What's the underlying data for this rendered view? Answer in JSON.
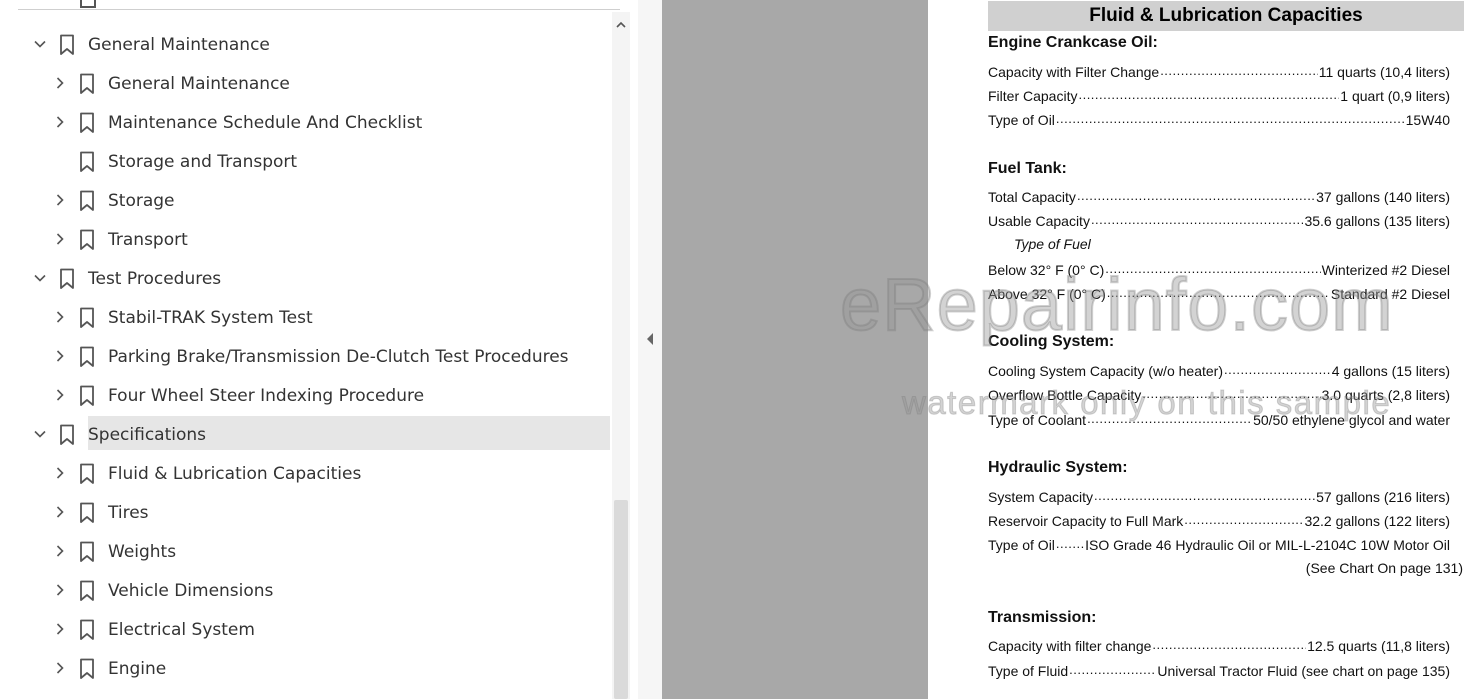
{
  "sidebar": {
    "items": [
      {
        "label": "General Maintenance",
        "level": 0,
        "expanded": true
      },
      {
        "label": "General Maintenance",
        "level": 1,
        "expanded": false
      },
      {
        "label": "Maintenance Schedule And Checklist",
        "level": 1,
        "expanded": false
      },
      {
        "label": "Storage and Transport",
        "level": 1,
        "leaf": true
      },
      {
        "label": "Storage",
        "level": 1,
        "expanded": false
      },
      {
        "label": "Transport",
        "level": 1,
        "expanded": false
      },
      {
        "label": "Test Procedures",
        "level": 0,
        "expanded": true
      },
      {
        "label": "Stabil-TRAK System Test",
        "level": 1,
        "expanded": false
      },
      {
        "label": "Parking Brake/Transmission De-Clutch Test Procedures",
        "level": 1,
        "expanded": false
      },
      {
        "label": "Four Wheel Steer Indexing Procedure",
        "level": 1,
        "expanded": false
      },
      {
        "label": "Specifications",
        "level": 0,
        "expanded": true,
        "selected": true
      },
      {
        "label": "Fluid & Lubrication Capacities",
        "level": 1,
        "expanded": false
      },
      {
        "label": "Tires",
        "level": 1,
        "expanded": false
      },
      {
        "label": "Weights",
        "level": 1,
        "expanded": false
      },
      {
        "label": "Vehicle Dimensions",
        "level": 1,
        "expanded": false
      },
      {
        "label": "Electrical System",
        "level": 1,
        "expanded": false
      },
      {
        "label": "Engine",
        "level": 1,
        "expanded": false
      }
    ]
  },
  "document": {
    "title": "Fluid & Lubrication Capacities",
    "sections": [
      {
        "heading": "Engine Crankcase Oil:",
        "rows": [
          {
            "label": "Capacity with Filter Change",
            "value": "11 quarts (10,4 liters)"
          },
          {
            "label": "Filter Capacity",
            "value": "1 quart (0,9 liters)"
          },
          {
            "label": "Type of Oil",
            "value": "15W40"
          }
        ]
      },
      {
        "heading": "Fuel Tank:",
        "rows": [
          {
            "label": "Total Capacity",
            "value": "37 gallons (140 liters)"
          },
          {
            "label": "Usable Capacity",
            "value": "35.6 gallons (135 liters)"
          },
          {
            "label": "Below 32° F (0° C)",
            "value": "Winterized #2 Diesel"
          },
          {
            "label": "Above 32° F (0° C)",
            "value": "Standard #2 Diesel"
          }
        ],
        "subheading": "Type of Fuel"
      },
      {
        "heading": "Cooling System:",
        "rows": [
          {
            "label": "Cooling System Capacity (w/o heater)",
            "value": "4 gallons (15 liters)"
          },
          {
            "label": "Overflow Bottle Capacity",
            "value": "3.0 quarts (2,8 liters)"
          },
          {
            "label": "Type of Coolant",
            "value": "50/50 ethylene glycol and water"
          }
        ]
      },
      {
        "heading": "Hydraulic System:",
        "rows": [
          {
            "label": "System Capacity",
            "value": "57 gallons (216 liters)"
          },
          {
            "label": "Reservoir Capacity to Full Mark",
            "value": "32.2 gallons (122 liters)"
          },
          {
            "label": "Type of Oil",
            "value": "ISO Grade 46 Hydraulic Oil or MIL-L-2104C 10W Motor Oil"
          }
        ],
        "note": "(See Chart On page 131)"
      },
      {
        "heading": "Transmission:",
        "rows": [
          {
            "label": "Capacity with filter change",
            "value": "12.5 quarts (11,8 liters)"
          },
          {
            "label": "Type of Fluid",
            "value": "Universal Tractor Fluid (see chart on page 135)"
          }
        ]
      }
    ]
  },
  "watermark": {
    "main": "eRepairinfo.com",
    "sub": "watermark only on this sample"
  },
  "colors": {
    "selected_row": "#e6e6e6",
    "gray_panel": "#a8a8a8",
    "title_bar": "#d0d0d0"
  },
  "icons": {
    "expanded": "chevron-down-icon",
    "collapsed": "chevron-right-icon",
    "bookmark": "bookmark-icon",
    "scroll_up": "caret-up-icon",
    "collapse_panel": "caret-left-icon"
  }
}
